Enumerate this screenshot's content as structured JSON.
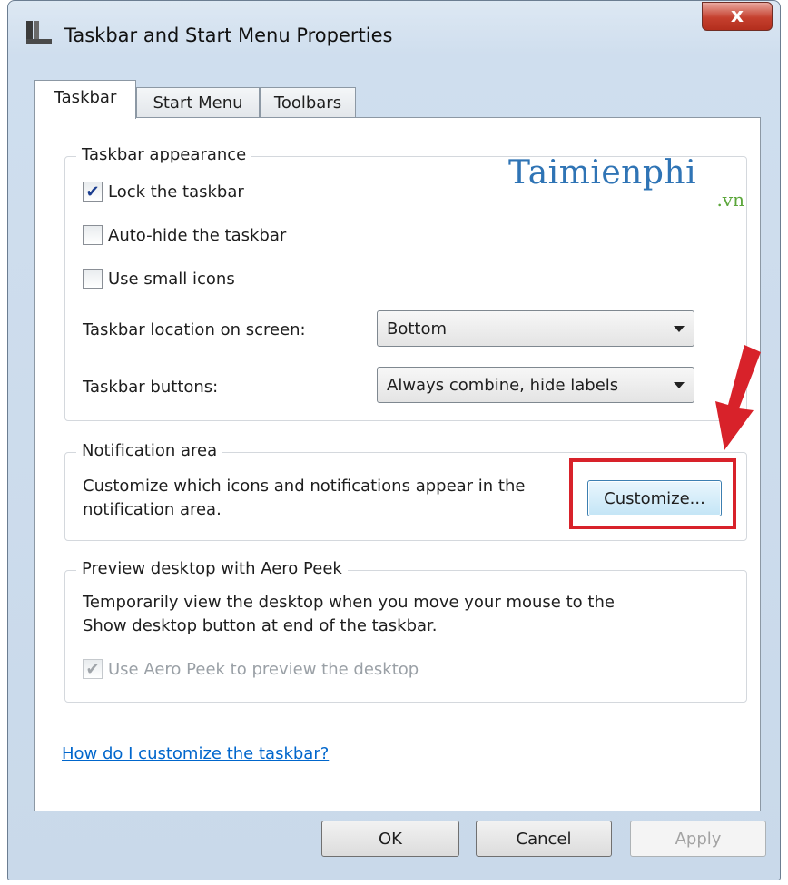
{
  "window": {
    "title": "Taskbar and Start Menu Properties",
    "close_label": "x"
  },
  "tabs": [
    {
      "label": "Taskbar"
    },
    {
      "label": "Start Menu"
    },
    {
      "label": "Toolbars"
    }
  ],
  "watermark": {
    "text": "Taimienphi",
    "sub": ".vn"
  },
  "taskbar_appearance": {
    "label": "Taskbar appearance",
    "lock": {
      "label": "Lock the taskbar",
      "checked": true
    },
    "autohide": {
      "label": "Auto-hide the taskbar",
      "checked": false
    },
    "small_icons": {
      "label": "Use small icons",
      "checked": false
    },
    "location_label": "Taskbar location on screen:",
    "location_value": "Bottom",
    "buttons_label": "Taskbar buttons:",
    "buttons_value": "Always combine, hide labels"
  },
  "notification_area": {
    "label": "Notification area",
    "desc_line1": "Customize which icons and notifications appear in the",
    "desc_line2": "notification area.",
    "customize_label": "Customize..."
  },
  "aero_peek": {
    "label": "Preview desktop with Aero Peek",
    "desc_line1": "Temporarily view the desktop when you move your mouse to the",
    "desc_line2": "Show desktop button at end of the taskbar.",
    "use_label": "Use Aero Peek to preview the desktop",
    "use_checked": true
  },
  "help_link": "How do I customize the taskbar?",
  "footer": {
    "ok_label": "OK",
    "cancel_label": "Cancel",
    "apply_label": "Apply"
  },
  "colors": {
    "highlight": "#d8222a",
    "link": "#0066cc"
  }
}
